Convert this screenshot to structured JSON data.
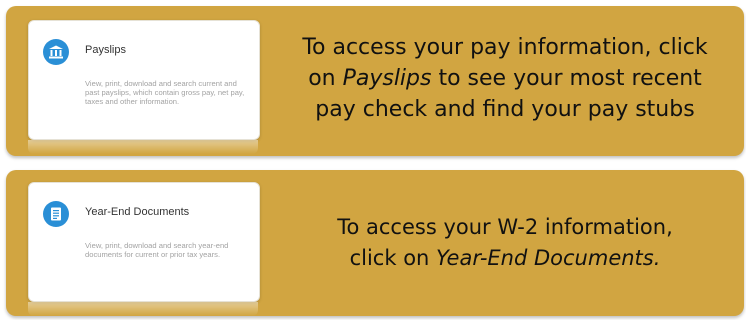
{
  "panels": [
    {
      "tile": {
        "icon": "bank-icon",
        "title": "Payslips",
        "description": "View, print, download and search current and past payslips, which contain gross pay, net pay, taxes and other information."
      },
      "caption": {
        "line1": "To access your pay information, click",
        "line2_pre": "on ",
        "line2_em": "Payslips",
        "line2_post": " to see your most recent",
        "line3": "pay check and find your pay stubs"
      }
    },
    {
      "tile": {
        "icon": "document-icon",
        "title": "Year-End Documents",
        "description": "View, print, download and search year-end documents for current or prior tax years."
      },
      "caption": {
        "line1": "To access your W-2 information,",
        "line2_pre": "click on ",
        "line2_em": "Year-End Documents."
      }
    }
  ],
  "colors": {
    "panel": "#d1a541",
    "icon_blue": "#2a8fd6"
  }
}
